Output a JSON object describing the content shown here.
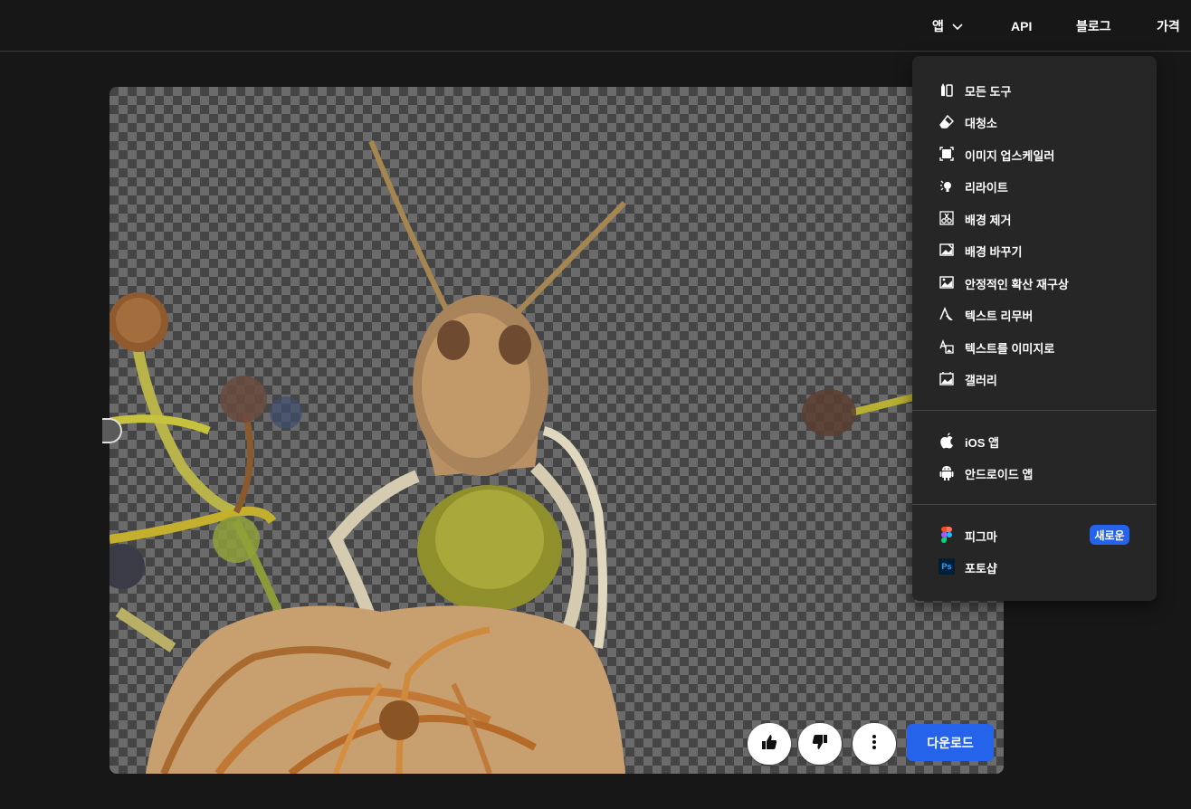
{
  "nav": {
    "apps_label": "앱",
    "api_label": "API",
    "blog_label": "블로그",
    "pricing_label": "가격"
  },
  "menu": {
    "tools": [
      {
        "label": "모든 도구",
        "icon": "all-tools-icon"
      },
      {
        "label": "대청소",
        "icon": "eraser-icon"
      },
      {
        "label": "이미지 업스케일러",
        "icon": "upscale-icon"
      },
      {
        "label": "리라이트",
        "icon": "relight-bulb-icon"
      },
      {
        "label": "배경 제거",
        "icon": "scissors-icon"
      },
      {
        "label": "배경 바꾸기",
        "icon": "replace-image-icon"
      },
      {
        "label": "안정적인 확산 재구상",
        "icon": "reimagine-icon"
      },
      {
        "label": "텍스트 리무버",
        "icon": "text-remove-icon"
      },
      {
        "label": "텍스트를 이미지로",
        "icon": "text-to-image-icon"
      },
      {
        "label": "갤러리",
        "icon": "gallery-icon"
      }
    ],
    "apps": [
      {
        "label": "iOS 앱",
        "icon": "apple-icon"
      },
      {
        "label": "안드로이드 앱",
        "icon": "android-icon"
      }
    ],
    "integrations": [
      {
        "label": "피그마",
        "icon": "figma-icon",
        "badge": "새로운"
      },
      {
        "label": "포토샵",
        "icon": "photoshop-icon",
        "icon_text": "Ps"
      }
    ]
  },
  "actions": {
    "download_label": "다운로드",
    "like_icon": "thumbs-up-icon",
    "dislike_icon": "thumbs-down-icon",
    "more_icon": "more-vertical-icon"
  },
  "colors": {
    "accent": "#2563eb",
    "background": "#171717",
    "menu_bg": "#262626"
  }
}
